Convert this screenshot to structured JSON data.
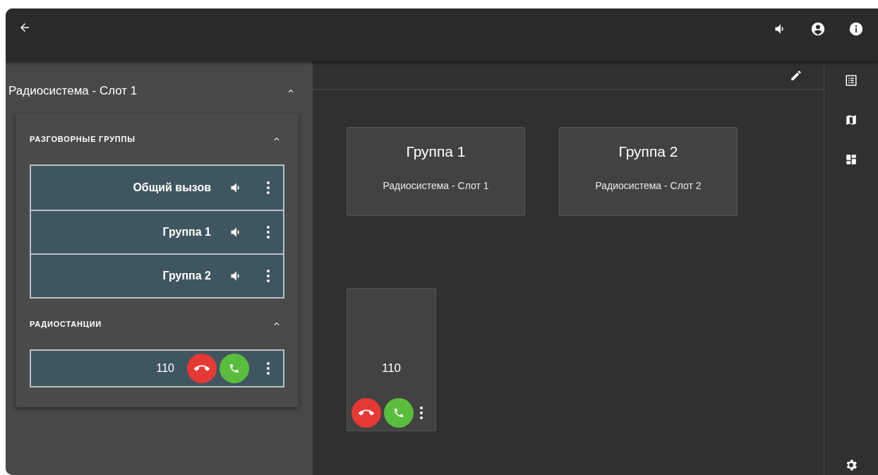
{
  "sidebar": {
    "title": "Радиосистема - Слот 1",
    "expanded": true,
    "sections": [
      {
        "kind": "groups",
        "title": "РАЗГОВОРНЫЕ ГРУППЫ",
        "expanded": true,
        "items": [
          {
            "label": "Общий вызов"
          },
          {
            "label": "Группа 1"
          },
          {
            "label": "Группа 2"
          }
        ]
      },
      {
        "kind": "stations",
        "title": "РАДИОСТАНЦИИ",
        "expanded": true,
        "items": [
          {
            "label": "110"
          }
        ]
      }
    ]
  },
  "group_cards": [
    {
      "title": "Группа 1",
      "subtitle": "Радиосистема - Слот 1"
    },
    {
      "title": "Группа 2",
      "subtitle": "Радиосистема - Слот 2"
    }
  ],
  "station_cards": [
    {
      "label": "110"
    }
  ]
}
